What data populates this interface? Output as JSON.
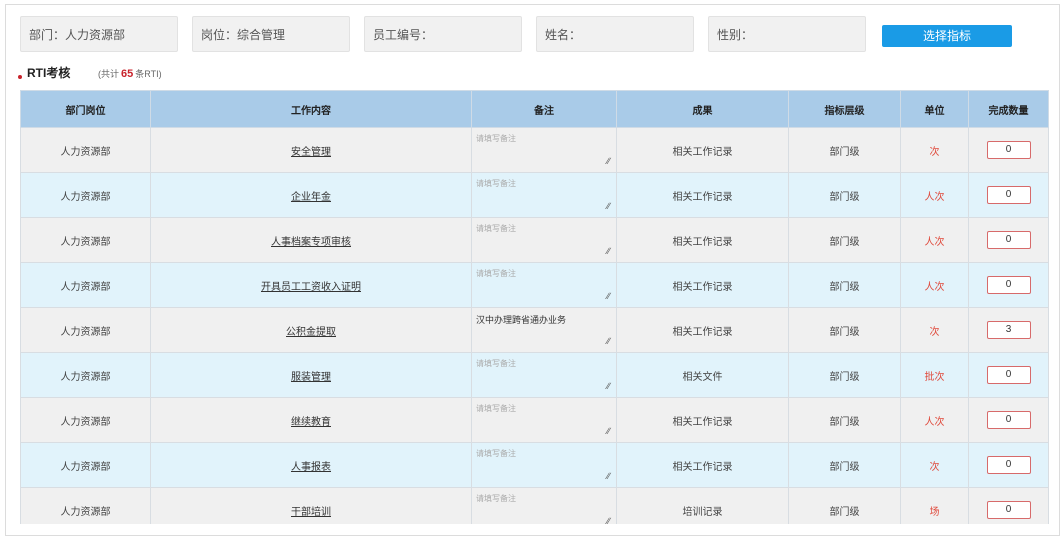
{
  "filters": {
    "department": "部门：人力资源部",
    "position": "岗位：综合管理",
    "employee_no": "员工编号：",
    "name": "姓名：",
    "gender": "性别：",
    "pick_button": "选择指标"
  },
  "section": {
    "title": "RTI考核",
    "count_prefix": "(共计",
    "count": "65",
    "count_suffix": "条RTI)"
  },
  "table": {
    "headers": [
      "部门岗位",
      "工作内容",
      "备注",
      "成果",
      "指标层级",
      "单位",
      "完成数量"
    ],
    "note_placeholder": "请填写备注",
    "rows": [
      {
        "dept": "人力资源部",
        "work": "安全管理",
        "note": "",
        "result": "相关工作记录",
        "level": "部门级",
        "unit": "次",
        "qty": "0"
      },
      {
        "dept": "人力资源部",
        "work": "企业年金",
        "note": "",
        "result": "相关工作记录",
        "level": "部门级",
        "unit": "人次",
        "qty": "0"
      },
      {
        "dept": "人力资源部",
        "work": "人事档案专项审核",
        "note": "",
        "result": "相关工作记录",
        "level": "部门级",
        "unit": "人次",
        "qty": "0"
      },
      {
        "dept": "人力资源部",
        "work": "开具员工工资收入证明",
        "note": "",
        "result": "相关工作记录",
        "level": "部门级",
        "unit": "人次",
        "qty": "0"
      },
      {
        "dept": "人力资源部",
        "work": "公积金提取",
        "note": "汉中办理跨省通办业务",
        "result": "相关工作记录",
        "level": "部门级",
        "unit": "次",
        "qty": "3"
      },
      {
        "dept": "人力资源部",
        "work": "服装管理",
        "note": "",
        "result": "相关文件",
        "level": "部门级",
        "unit": "批次",
        "qty": "0"
      },
      {
        "dept": "人力资源部",
        "work": "继续教育",
        "note": "",
        "result": "相关工作记录",
        "level": "部门级",
        "unit": "人次",
        "qty": "0"
      },
      {
        "dept": "人力资源部",
        "work": "人事报表",
        "note": "",
        "result": "相关工作记录",
        "level": "部门级",
        "unit": "次",
        "qty": "0"
      },
      {
        "dept": "人力资源部",
        "work": "干部培训",
        "note": "",
        "result": "培训记录",
        "level": "部门级",
        "unit": "场",
        "qty": "0"
      }
    ]
  }
}
